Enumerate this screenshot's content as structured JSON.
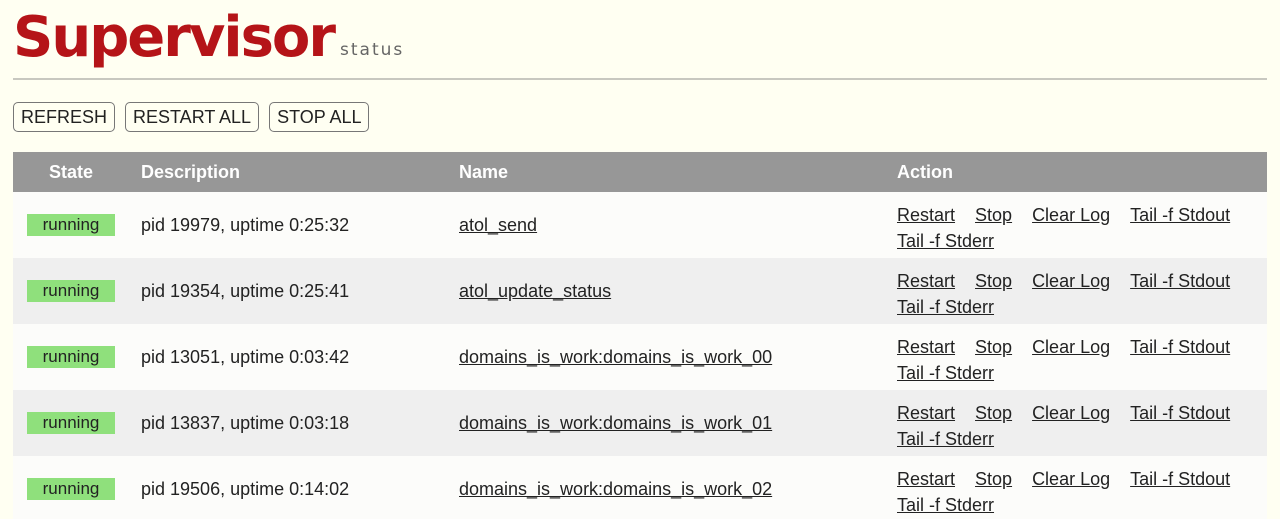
{
  "header": {
    "logo": "Supervisor",
    "subtitle": "status"
  },
  "toolbar": {
    "refresh_label": "REFRESH",
    "restart_all_label": "RESTART ALL",
    "stop_all_label": "STOP ALL"
  },
  "table": {
    "columns": {
      "state": "State",
      "description": "Description",
      "name": "Name",
      "action": "Action"
    },
    "actions": {
      "restart": "Restart",
      "stop": "Stop",
      "clear_log": "Clear Log",
      "tail_stdout": "Tail -f Stdout",
      "tail_stderr": "Tail -f Stderr"
    },
    "rows": [
      {
        "state": "running",
        "description": "pid 19979, uptime 0:25:32",
        "name": "atol_send"
      },
      {
        "state": "running",
        "description": "pid 19354, uptime 0:25:41",
        "name": "atol_update_status"
      },
      {
        "state": "running",
        "description": "pid 13051, uptime 0:03:42",
        "name": "domains_is_work:domains_is_work_00"
      },
      {
        "state": "running",
        "description": "pid 13837, uptime 0:03:18",
        "name": "domains_is_work:domains_is_work_01"
      },
      {
        "state": "running",
        "description": "pid 19506, uptime 0:14:02",
        "name": "domains_is_work:domains_is_work_02"
      }
    ]
  },
  "colors": {
    "brand": "#b51418",
    "running_badge": "#8fe07c",
    "header_bar": "#979797",
    "background": "#fffff2"
  }
}
